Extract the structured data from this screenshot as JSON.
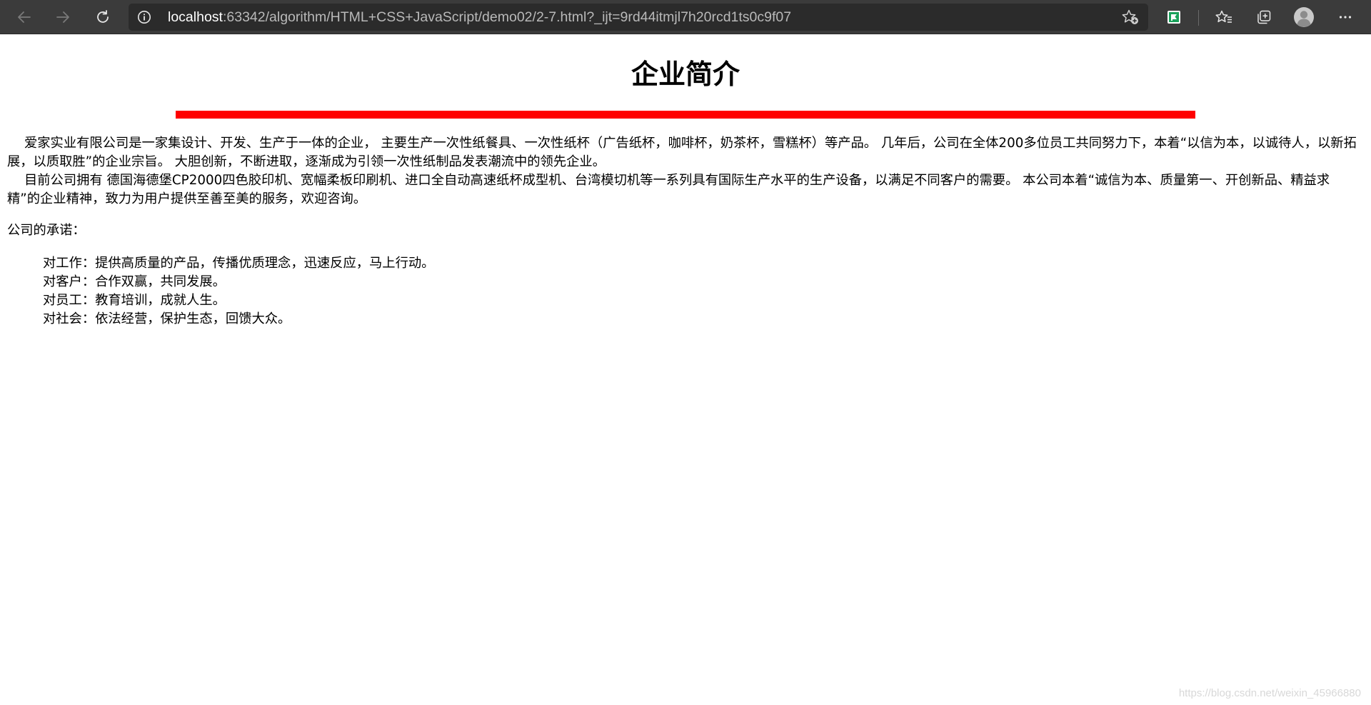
{
  "browser": {
    "url_host": "localhost",
    "url_rest": ":63342/algorithm/HTML+CSS+JavaScript/demo02/2-7.html?_ijt=9rd44itmjl7h20rcd1ts0c9f07",
    "icons": {
      "back": "back-arrow-icon",
      "forward": "forward-arrow-icon",
      "refresh": "refresh-icon",
      "site_info": "info-icon",
      "add_favorite": "star-plus-icon",
      "extension": "extension-icon",
      "favorites": "favorites-icon",
      "collections": "collections-icon",
      "profile": "profile-icon",
      "more": "more-icon"
    }
  },
  "content": {
    "title": "企业简介",
    "paragraphs": [
      "爱家实业有限公司是一家集设计、开发、生产于一体的企业， 主要生产一次性纸餐具、一次性纸杯（广告纸杯，咖啡杯，奶茶杯，雪糕杯）等产品。 几年后，公司在全体200多位员工共同努力下，本着“以信为本，以诚待人，以新拓展，以质取胜”的企业宗旨。 大胆创新，不断进取，逐渐成为引领一次性纸制品发表潮流中的领先企业。",
      "目前公司拥有 德国海德堡CP2000四色胶印机、宽幅柔板印刷机、进口全自动高速纸杯成型机、台湾模切机等一系列具有国际生产水平的生产设备，以满足不同客户的需要。 本公司本着“诚信为本、质量第一、开创新品、精益求精”的企业精神，致力为用户提供至善至美的服务，欢迎咨询。"
    ],
    "promise_label": "公司的承诺：",
    "promises": [
      "对工作：提供高质量的产品，传播优质理念，迅速反应，马上行动。",
      "对客户：合作双赢，共同发展。",
      "对员工：教育培训，成就人生。",
      "对社会：依法经营，保护生态，回馈大众。"
    ],
    "rule_color": "#ff0000"
  },
  "watermark": "https://blog.csdn.net/weixin_45966880"
}
